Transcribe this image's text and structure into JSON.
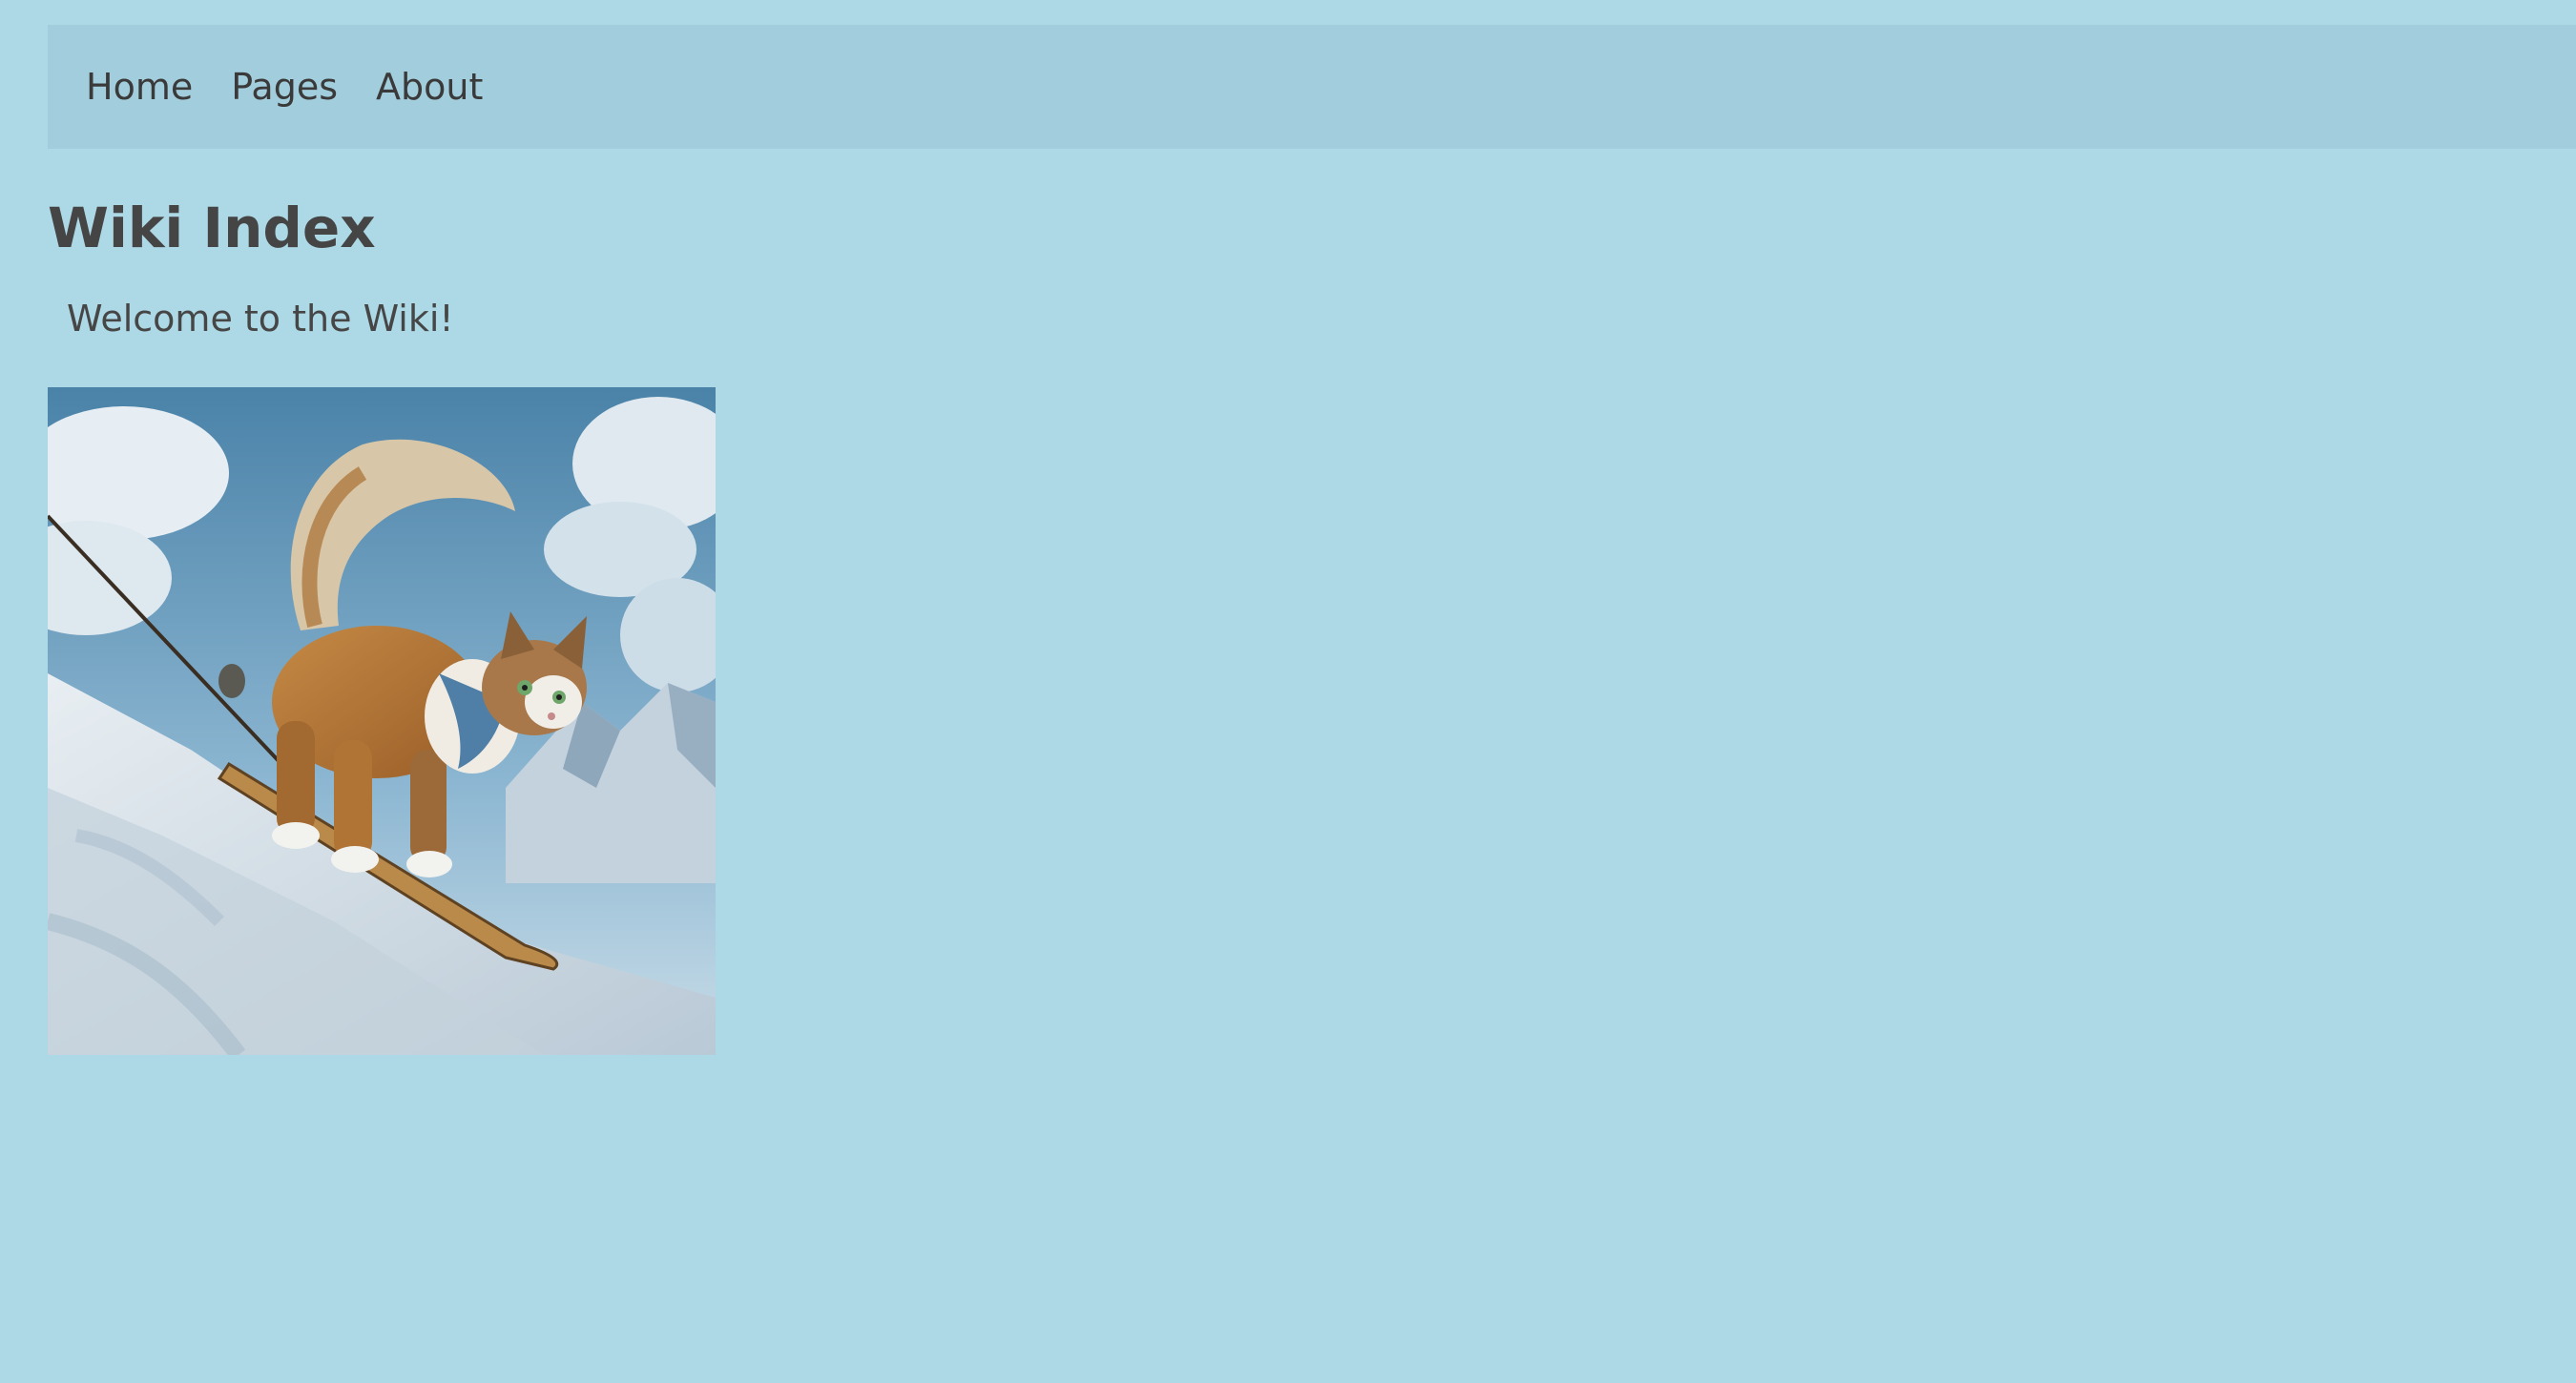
{
  "nav": {
    "items": [
      {
        "label": "Home"
      },
      {
        "label": "Pages"
      },
      {
        "label": "About"
      }
    ]
  },
  "main": {
    "title": "Wiki Index",
    "welcome": "Welcome to the Wiki!"
  },
  "image": {
    "subject": "cat-skiing-image"
  },
  "colors": {
    "background": "#add8e6",
    "navbar": "#a2cddd",
    "text": "#464646"
  }
}
